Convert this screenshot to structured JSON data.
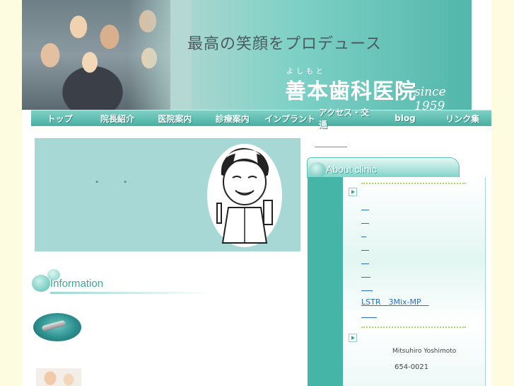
{
  "header": {
    "slogan": "最高の笑顔をプロデュース",
    "furigana": "よしもと",
    "clinic_name": "善本歯科医院",
    "since": "since 1959"
  },
  "nav": {
    "items": [
      "トップ",
      "院長紹介",
      "医院案内",
      "診療案内",
      "インプラント",
      "アクセス・交通",
      "blog",
      "リンク集"
    ]
  },
  "feature": {
    "quote_open": "\"",
    "quote_close": "\""
  },
  "information": {
    "title": "Information"
  },
  "about": {
    "title": "About clinic",
    "lstr_link": "LSTR　3Mix-MP　",
    "doctor": "Mitsuhiro Yoshimoto",
    "zip": "654-0021"
  },
  "colors": {
    "background": "#fdfbe0",
    "accent": "#45b5a8",
    "link": "#2b6fbf"
  }
}
